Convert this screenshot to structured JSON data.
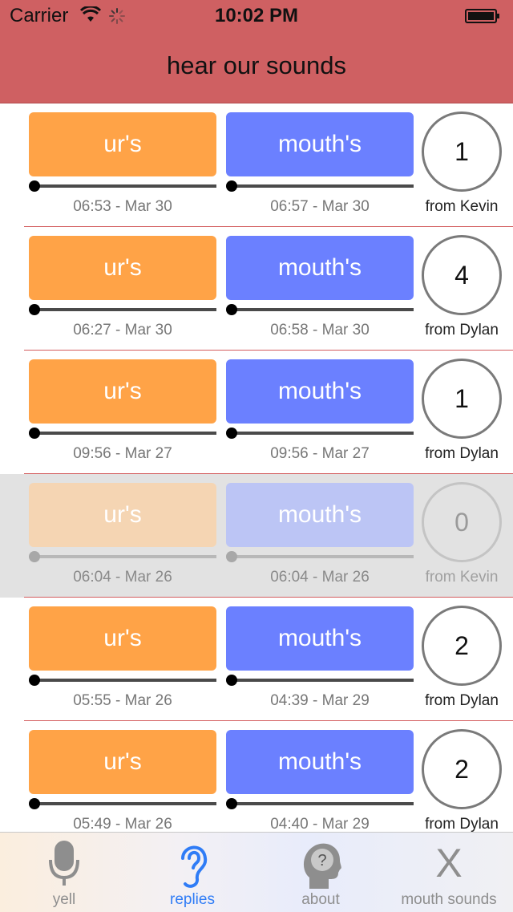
{
  "status_bar": {
    "carrier": "Carrier",
    "time": "10:02 PM"
  },
  "nav": {
    "title": "hear our sounds"
  },
  "replies": [
    {
      "ur_label": "ur's",
      "mouth_label": "mouth's",
      "ur_time": "06:53 - Mar 30",
      "mouth_time": "06:57 - Mar 30",
      "count": "1",
      "from": "from Kevin",
      "dimmed": false
    },
    {
      "ur_label": "ur's",
      "mouth_label": "mouth's",
      "ur_time": "06:27 - Mar 30",
      "mouth_time": "06:58 - Mar 30",
      "count": "4",
      "from": "from Dylan",
      "dimmed": false
    },
    {
      "ur_label": "ur's",
      "mouth_label": "mouth's",
      "ur_time": "09:56 - Mar 27",
      "mouth_time": "09:56 - Mar 27",
      "count": "1",
      "from": "from Dylan",
      "dimmed": false
    },
    {
      "ur_label": "ur's",
      "mouth_label": "mouth's",
      "ur_time": "06:04 - Mar 26",
      "mouth_time": "06:04 - Mar 26",
      "count": "0",
      "from": "from Kevin",
      "dimmed": true
    },
    {
      "ur_label": "ur's",
      "mouth_label": "mouth's",
      "ur_time": "05:55 - Mar 26",
      "mouth_time": "04:39 - Mar 29",
      "count": "2",
      "from": "from Dylan",
      "dimmed": false
    },
    {
      "ur_label": "ur's",
      "mouth_label": "mouth's",
      "ur_time": "05:49 - Mar 26",
      "mouth_time": "04:40 - Mar 29",
      "count": "2",
      "from": "from Dylan",
      "dimmed": false
    }
  ],
  "tabs": [
    {
      "label": "yell",
      "icon": "microphone-icon",
      "active": false
    },
    {
      "label": "replies",
      "icon": "ear-icon",
      "active": true
    },
    {
      "label": "about",
      "icon": "head-question-icon",
      "active": false
    },
    {
      "label": "mouth sounds",
      "icon": "x-icon",
      "active": false
    }
  ],
  "colors": {
    "header": "#cf6062",
    "ur_button": "#ffa347",
    "mouth_button": "#6b80ff",
    "active_tab": "#2f7cf6"
  }
}
